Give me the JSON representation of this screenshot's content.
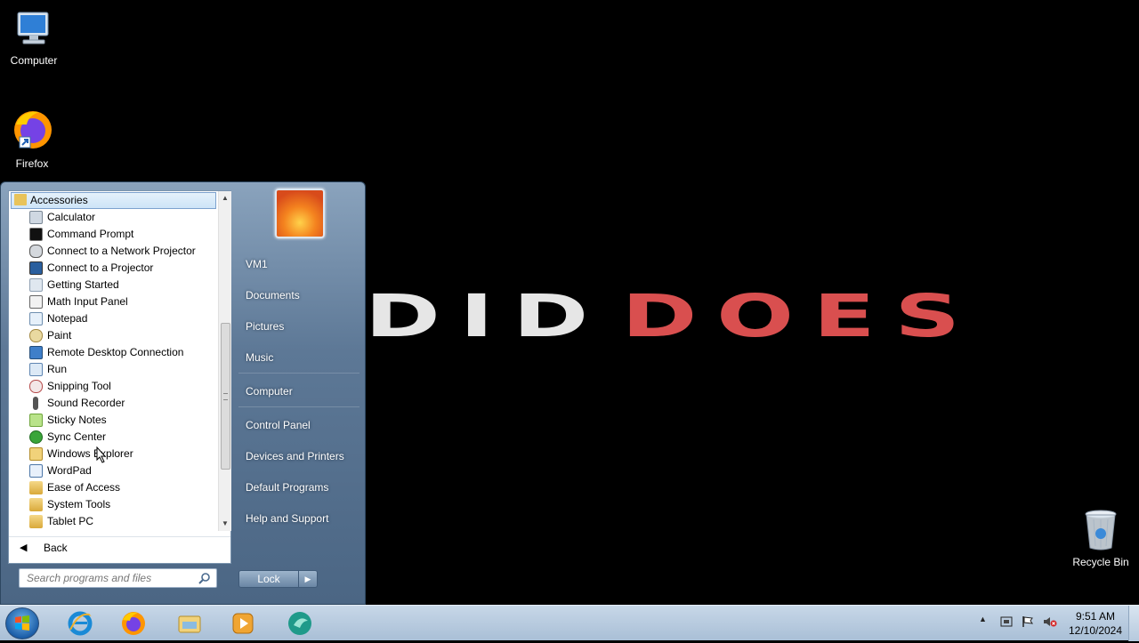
{
  "desktop": {
    "icons": [
      {
        "label": "Computer"
      },
      {
        "label": "Firefox"
      },
      {
        "label": "Recycle Bin"
      }
    ],
    "wallpaper": {
      "text_light": "DID",
      "text_accent": "DOES",
      "accent_color": "#d94f4f"
    }
  },
  "start_menu": {
    "folder_header": "Accessories",
    "programs": [
      {
        "label": "Calculator",
        "icon": "calculator-icon"
      },
      {
        "label": "Command Prompt",
        "icon": "command-prompt-icon"
      },
      {
        "label": "Connect to a Network Projector",
        "icon": "network-projector-icon"
      },
      {
        "label": "Connect to a Projector",
        "icon": "projector-icon"
      },
      {
        "label": "Getting Started",
        "icon": "getting-started-icon"
      },
      {
        "label": "Math Input Panel",
        "icon": "math-input-icon"
      },
      {
        "label": "Notepad",
        "icon": "notepad-icon"
      },
      {
        "label": "Paint",
        "icon": "paint-icon"
      },
      {
        "label": "Remote Desktop Connection",
        "icon": "remote-desktop-icon"
      },
      {
        "label": "Run",
        "icon": "run-icon"
      },
      {
        "label": "Snipping Tool",
        "icon": "snipping-tool-icon"
      },
      {
        "label": "Sound Recorder",
        "icon": "sound-recorder-icon"
      },
      {
        "label": "Sticky Notes",
        "icon": "sticky-notes-icon"
      },
      {
        "label": "Sync Center",
        "icon": "sync-center-icon"
      },
      {
        "label": "Windows Explorer",
        "icon": "windows-explorer-icon"
      },
      {
        "label": "WordPad",
        "icon": "wordpad-icon"
      },
      {
        "label": "Ease of Access",
        "icon": "folder-icon"
      },
      {
        "label": "System Tools",
        "icon": "folder-icon"
      },
      {
        "label": "Tablet PC",
        "icon": "folder-icon"
      }
    ],
    "back_label": "Back",
    "search_placeholder": "Search programs and files",
    "right_items": [
      "VM1",
      "Documents",
      "Pictures",
      "Music",
      "Computer",
      "Control Panel",
      "Devices and Printers",
      "Default Programs",
      "Help and Support"
    ],
    "lock_label": "Lock"
  },
  "taskbar": {
    "pinned": [
      "internet-explorer-icon",
      "firefox-icon",
      "windows-explorer-icon",
      "media-player-icon",
      "app-icon"
    ],
    "clock_time": "9:51 AM",
    "clock_date": "12/10/2024"
  }
}
